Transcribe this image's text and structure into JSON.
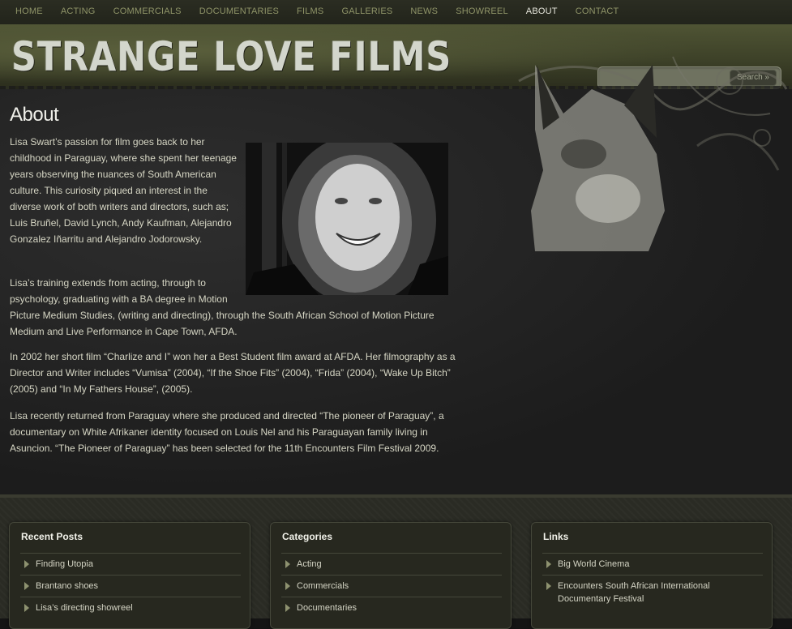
{
  "nav": {
    "items": [
      "HOME",
      "ACTING",
      "COMMERCIALS",
      "DOCUMENTARIES",
      "FILMS",
      "GALLERIES",
      "NEWS",
      "SHOWREEL",
      "ABOUT",
      "CONTACT"
    ],
    "active": "ABOUT"
  },
  "header": {
    "logo": "STRANGE LOVE FILMS",
    "search": {
      "placeholder": "",
      "button_label": "Search »"
    }
  },
  "main": {
    "title": "About",
    "paragraphs": [
      "Lisa Swart’s passion for film goes back to her childhood in Paraguay, where she spent her teenage years observing the nuances of South American culture. This curiosity piqued an interest in the diverse work of both writers and directors, such as; Luis Bruñel, David Lynch, Andy Kaufman, Alejandro Gonzalez Iñarritu and Alejandro Jodorowsky.",
      "Lisa’s training extends from acting, through to psychology, graduating with a BA degree in Motion",
      "Picture Medium Studies, (writing and directing), through the South African School of Motion Picture Medium and Live Performance in Cape Town, AFDA.",
      "In 2002 her short film “Charlize and I” won her a Best Student film award at AFDA. Her filmography as a Director and Writer includes  “Vumisa” (2004), “If the Shoe Fits” (2004), “Frida” (2004), “Wake Up Bitch” (2005) and “In My Fathers House”, (2005).",
      "Lisa recently returned from Paraguay where she produced and directed “The pioneer of Paraguay”, a documentary on White Afrikaner identity focused on Louis Nel and his Paraguayan family living in Asuncion. “The Pioneer of Paraguay”  has been selected for the 11th Encounters Film Festival 2009."
    ]
  },
  "footer": {
    "recent_posts": {
      "title": "Recent Posts",
      "items": [
        "Finding Utopia",
        "Brantano shoes",
        "Lisa’s directing showreel"
      ]
    },
    "categories": {
      "title": "Categories",
      "items": [
        "Acting",
        "Commercials",
        "Documentaries"
      ]
    },
    "links": {
      "title": "Links",
      "items": [
        "Big World Cinema",
        "Encounters South African International Documentary Festival"
      ]
    }
  },
  "colors": {
    "nav_text": "#8f9468",
    "nav_active": "#e6e6dc",
    "header_olive": "#4f5434",
    "body_text": "#d6d6c4"
  }
}
